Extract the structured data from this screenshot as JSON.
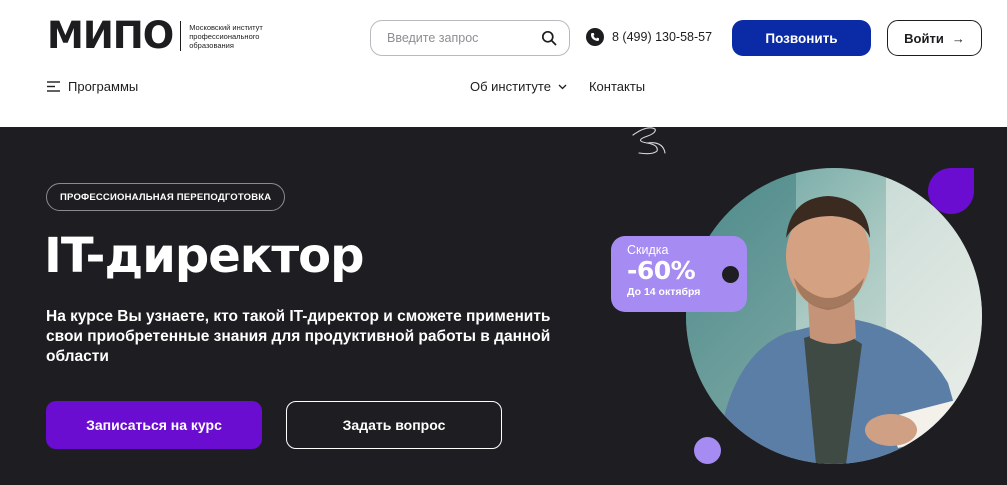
{
  "header": {
    "logo_word": "МИПО",
    "logo_subtitle": "Московский институт профессионального образования",
    "search_placeholder": "Введите запрос",
    "phone": "8 (499) 130-58-57",
    "call_label": "Позвонить",
    "login_label": "Войти",
    "login_arrow": "→",
    "programs_label": "Программы",
    "nav": {
      "about_label": "Об институте",
      "contacts_label": "Контакты"
    }
  },
  "hero": {
    "badge": "ПРОФЕССИОНАЛЬНАЯ ПЕРЕПОДГОТОВКА",
    "title": "IT-директор",
    "description": "На курсе Вы узнаете, кто такой IT-директор и сможете применить свои приобретенные знания для продуктивной работы в данной области",
    "enroll_label": "Записаться на курс",
    "ask_label": "Задать вопрос",
    "discount": {
      "label": "Скидка",
      "value": "-60%",
      "until": "До 14 октября"
    }
  },
  "icons": {
    "search": "search-icon",
    "phone": "phone-icon",
    "menu": "menu-icon",
    "chevron": "chevron-down-icon",
    "arrow": "arrow-right-icon"
  },
  "colors": {
    "primary_blue": "#0a2aa6",
    "accent_purple": "#6a0dd0",
    "lilac": "#a58bf2",
    "hero_bg": "#1e1e22"
  }
}
